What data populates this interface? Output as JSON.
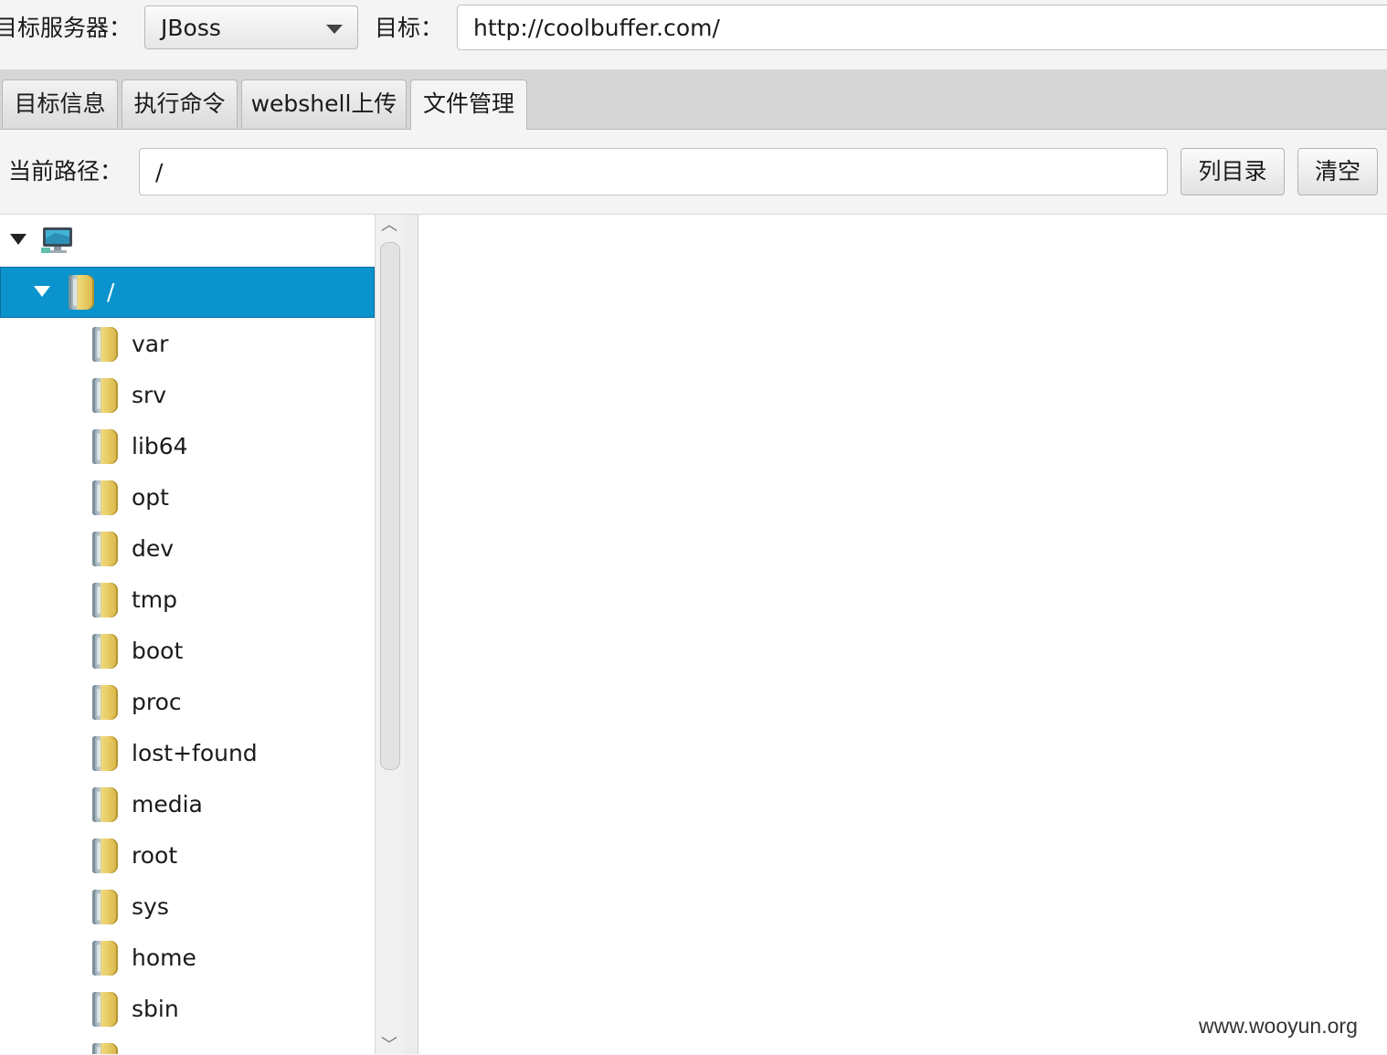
{
  "header": {
    "server_label": "目标服务器：",
    "server_value": "JBoss",
    "target_label": "目标：",
    "target_value": "http://coolbuffer.com/"
  },
  "tabs": [
    {
      "label": "目标信息"
    },
    {
      "label": "执行命令"
    },
    {
      "label": "webshell上传"
    },
    {
      "label": "文件管理",
      "active": true
    }
  ],
  "pathbar": {
    "label": "当前路径：",
    "value": "/",
    "list_button": "列目录",
    "clear_button": "清空"
  },
  "tree": {
    "root_icon": "computer-icon",
    "selected": {
      "label": "/"
    },
    "folders": [
      "var",
      "srv",
      "lib64",
      "opt",
      "dev",
      "tmp",
      "boot",
      "proc",
      "lost+found",
      "media",
      "root",
      "sys",
      "home",
      "sbin"
    ]
  },
  "watermark": "www.wooyun.org",
  "colors": {
    "selection": "#0a93cc",
    "folder": "#d9b546"
  }
}
